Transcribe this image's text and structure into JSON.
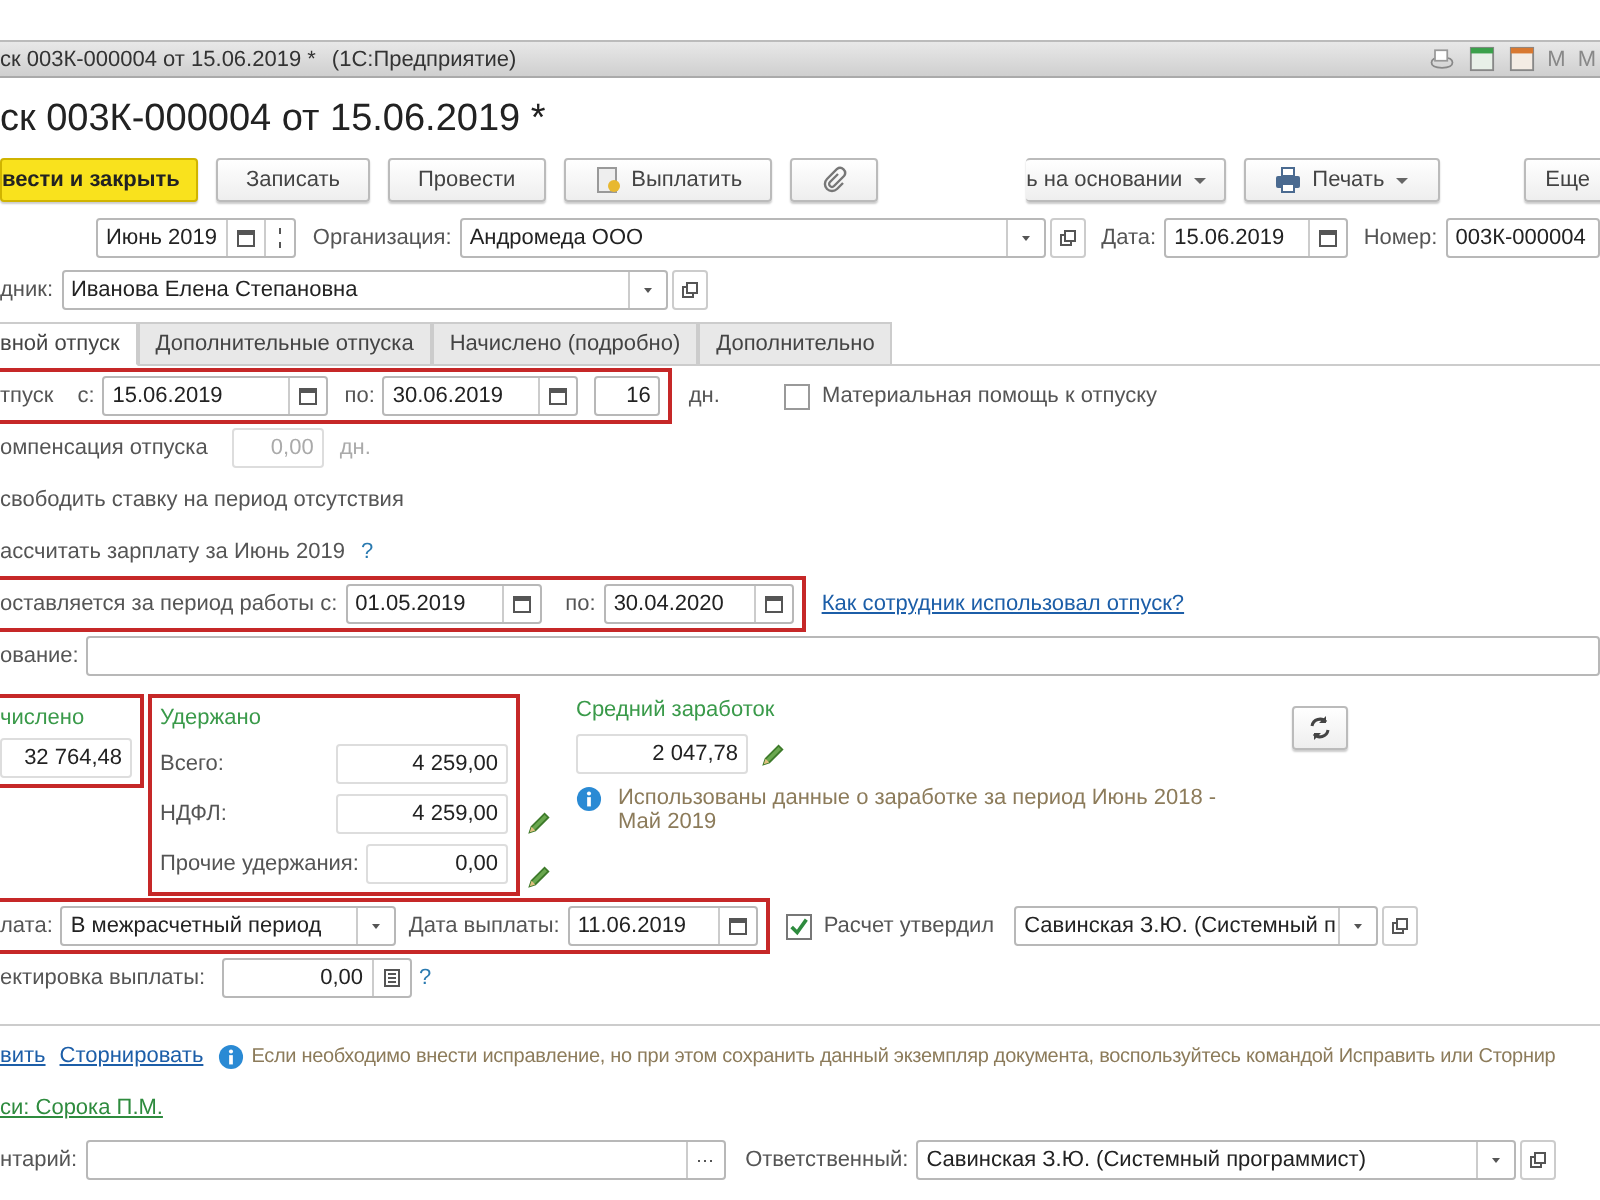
{
  "window": {
    "title": "ск 003К-000004 от 15.06.2019 *",
    "app": "(1С:Предприятие)",
    "indicators": [
      "M",
      "M"
    ]
  },
  "heading": "ск 003К-000004 от 15.06.2019 *",
  "toolbar": [
    {
      "kind": "primary",
      "label": "вести и закрыть"
    },
    {
      "kind": "plain",
      "label": "Записать"
    },
    {
      "kind": "plain",
      "label": "Провести"
    },
    {
      "kind": "pay",
      "label": "Выплатить"
    },
    {
      "kind": "attach"
    },
    {
      "kind": "dropdown",
      "label": "ь на основании"
    },
    {
      "kind": "print",
      "label": "Печать"
    },
    {
      "kind": "more",
      "label": "Еще"
    }
  ],
  "header": {
    "month": "Июнь 2019",
    "org_label": "Организация:",
    "org": "Андромеда ООО",
    "date_label": "Дата:",
    "date": "15.06.2019",
    "number_label": "Номер:",
    "number": "003К-000004"
  },
  "employee": {
    "label": "дник:",
    "value": "Иванова Елена Степановна"
  },
  "tabs": [
    {
      "label": "вной отпуск",
      "selected": true
    },
    {
      "label": "Дополнительные отпуска",
      "selected": false
    },
    {
      "label": "Начислено (подробно)",
      "selected": false
    },
    {
      "label": "Дополнительно",
      "selected": false
    }
  ],
  "vacation": {
    "label": "тпуск",
    "from_label": "с:",
    "from": "15.06.2019",
    "to_label": "по:",
    "to": "30.06.2019",
    "days": "16",
    "unit": "дн."
  },
  "material_aid": {
    "label": "Материальная помощь к отпуску",
    "checked": false
  },
  "compensation": {
    "label": "омпенсация отпуска",
    "value": "0,00",
    "unit": "дн.",
    "disabled": true
  },
  "free_rate": "свободить ставку на период отсутствия",
  "recalc": {
    "label": "ассчитать зарплату за Июнь 2019",
    "help": "?"
  },
  "period": {
    "label": "оставляется за период работы с:",
    "from": "01.05.2019",
    "to_label": "по:",
    "to": "30.04.2020",
    "link": "Как сотрудник использовал отпуск?"
  },
  "basis": {
    "label": "ование:"
  },
  "accrued": {
    "title": "числено",
    "value": "32 764,48"
  },
  "withheld": {
    "title": "Удержано",
    "rows": [
      {
        "label": "Всего:",
        "value": "4 259,00",
        "editable": false
      },
      {
        "label": "НДФЛ:",
        "value": "4 259,00",
        "editable": true
      },
      {
        "label": "Прочие удержания:",
        "value": "0,00",
        "editable": true
      }
    ]
  },
  "average": {
    "title": "Средний заработок",
    "value": "2 047,78",
    "note": "Использованы данные о заработке за период Июнь 2018 - Май 2019"
  },
  "payment": {
    "label": "лата:",
    "value": "В межрасчетный период",
    "date_label": "Дата выплаты:",
    "date": "11.06.2019"
  },
  "approved": {
    "label": "Расчет утвердил",
    "checked": true,
    "value": "Савинская З.Ю. (Системный п"
  },
  "correction": {
    "label": "ектировка выплаты:",
    "value": "0,00",
    "help": "?"
  },
  "actions": {
    "links": [
      "вить",
      "Сторнировать"
    ],
    "note": "Если необходимо внести исправление, но при этом сохранить данный экземпляр документа, воспользуйтесь командой Исправить или Сторнир"
  },
  "author_link": "си: Сорока П.М.",
  "comment": {
    "label": "нтарий:"
  },
  "responsible": {
    "label": "Ответственный:",
    "value": "Савинская З.Ю. (Системный программист)"
  }
}
